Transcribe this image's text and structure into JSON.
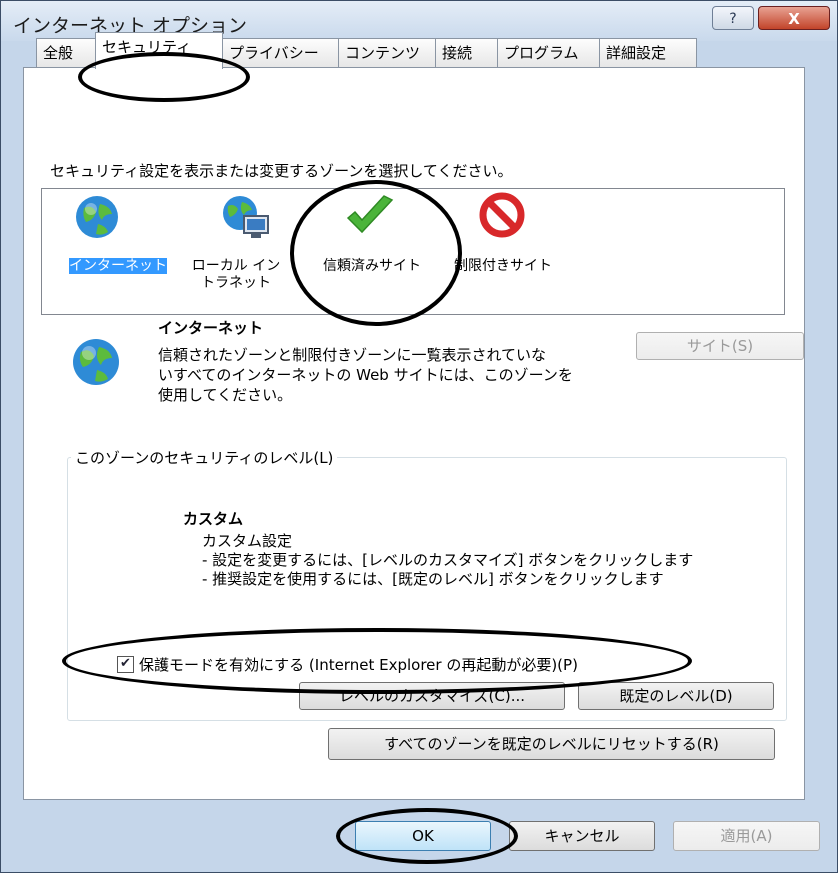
{
  "window": {
    "title": "インターネット オプション",
    "help_label": "?",
    "close_label": "X"
  },
  "tabs": [
    {
      "label": "全般"
    },
    {
      "label": "セキュリティ"
    },
    {
      "label": "プライバシー"
    },
    {
      "label": "コンテンツ"
    },
    {
      "label": "接続"
    },
    {
      "label": "プログラム"
    },
    {
      "label": "詳細設定"
    }
  ],
  "active_tab": "セキュリティ",
  "zone_prompt": "セキュリティ設定を表示または変更するゾーンを選択してください。",
  "zones": [
    {
      "label": "インターネット",
      "icon": "globe-icon",
      "selected": true
    },
    {
      "label": "ローカル イントラネット",
      "icon": "intranet-icon",
      "selected": false
    },
    {
      "label": "信頼済みサイト",
      "icon": "checkmark-icon",
      "selected": false
    },
    {
      "label": "制限付きサイト",
      "icon": "prohibited-icon",
      "selected": false
    }
  ],
  "zone_detail": {
    "name": "インターネット",
    "description_lines": [
      "信頼されたゾーンと制限付きゾーンに一覧表示されていな",
      "いすべてのインターネットの Web サイトには、このゾーンを",
      "使用してください。"
    ],
    "sites_button": "サイト(S)"
  },
  "security_level": {
    "group_label": "このゾーンのセキュリティのレベル(L)",
    "level_name": "カスタム",
    "lines": [
      "カスタム設定",
      "- 設定を変更するには、[レベルのカスタマイズ] ボタンをクリックします",
      "- 推奨設定を使用するには、[既定のレベル] ボタンをクリックします"
    ],
    "protected_mode": {
      "checked": true,
      "label": "保護モードを有効にする (Internet Explorer の再起動が必要)(P)"
    },
    "custom_level_button": "レベルのカスタマイズ(C)...",
    "default_level_button": "既定のレベル(D)"
  },
  "reset_all_button": "すべてのゾーンを既定のレベルにリセットする(R)",
  "footer": {
    "ok_button": "OK",
    "cancel_button": "キャンセル",
    "apply_button": "適用(A)"
  },
  "colors": {
    "selection": "#3399ff",
    "annotation": "#000000",
    "title_bar": "#c9d9ec",
    "close_button": "#c2442a"
  }
}
